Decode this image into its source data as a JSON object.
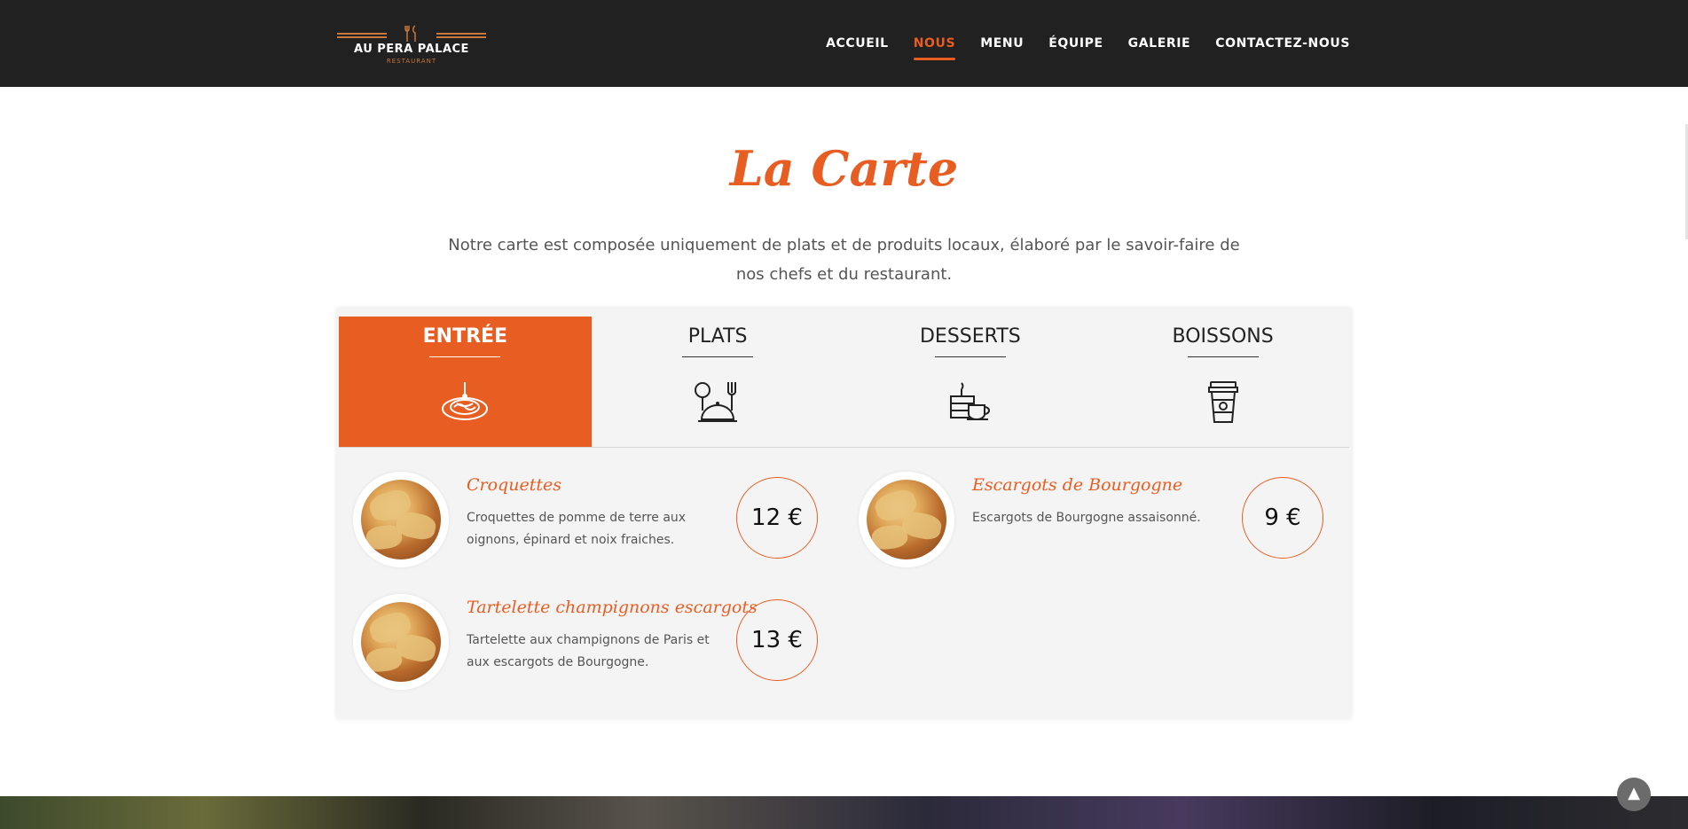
{
  "brand": {
    "name": "AU PERA PALACE",
    "subtitle": "RESTAURANT"
  },
  "nav": {
    "items": [
      {
        "label": "ACCUEIL",
        "active": false
      },
      {
        "label": "NOUS",
        "active": true
      },
      {
        "label": "MENU",
        "active": false
      },
      {
        "label": "ÉQUIPE",
        "active": false
      },
      {
        "label": "GALERIE",
        "active": false
      },
      {
        "label": "CONTACTEZ-NOUS",
        "active": false
      }
    ]
  },
  "section": {
    "title": "La Carte",
    "intro": "Notre carte est composée uniquement de plats et de produits locaux, élaboré par le savoir-faire de nos chefs et du restaurant."
  },
  "tabs": [
    {
      "label": "ENTRÉE",
      "icon": "spaghetti-plate-icon",
      "active": true
    },
    {
      "label": "PLATS",
      "icon": "cloche-cutlery-icon",
      "active": false
    },
    {
      "label": "DESSERTS",
      "icon": "cake-coffee-icon",
      "active": false
    },
    {
      "label": "BOISSONS",
      "icon": "coffee-cup-icon",
      "active": false
    }
  ],
  "items": [
    {
      "name": "Croquettes",
      "description": "Croquettes de pomme de terre aux oignons, épinard et noix fraiches.",
      "price": "12 €"
    },
    {
      "name": "Escargots de Bourgogne",
      "description": "Escargots de Bourgogne assaisonné.",
      "price": "9 €"
    },
    {
      "name": "Tartelette champignons escargots",
      "description": "Tartelette aux champignons de Paris et aux escargots de Bourgogne.",
      "price": "13 €"
    }
  ],
  "colors": {
    "accent": "#e85d22",
    "header_bg": "#212121",
    "panel_bg": "#f4f4f4"
  },
  "scroll_top_icon": "chevron-up-icon"
}
